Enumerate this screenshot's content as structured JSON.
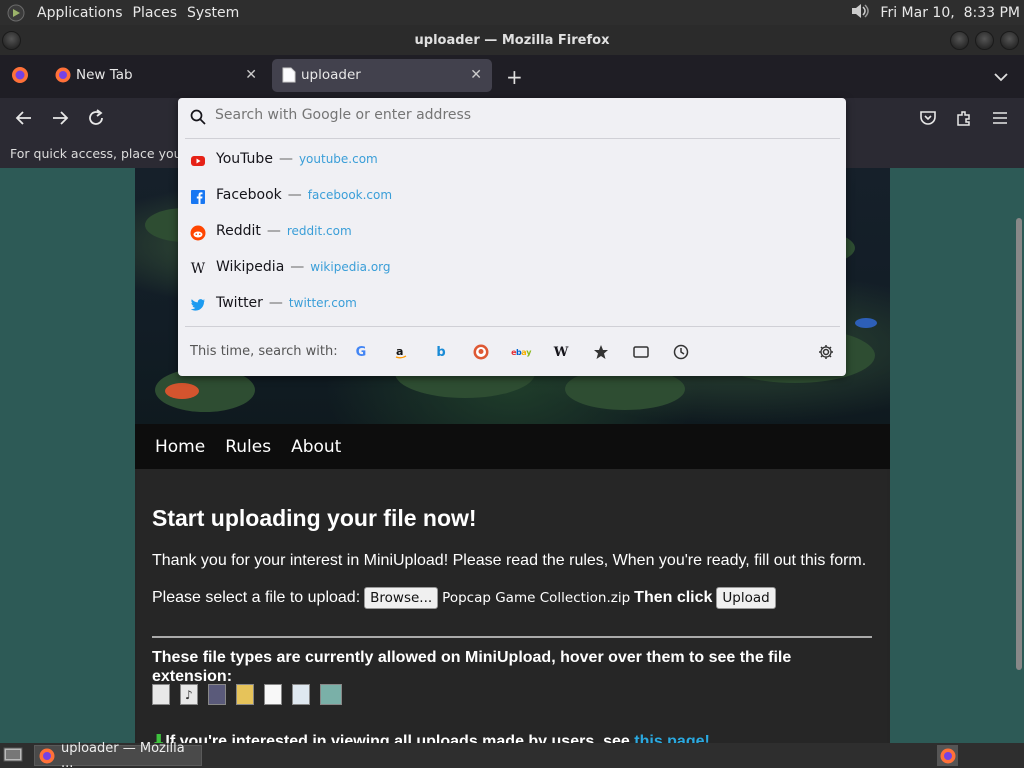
{
  "top_panel": {
    "menus": [
      "Applications",
      "Places",
      "System"
    ],
    "datetime": "Fri Mar 10,  8:33 PM"
  },
  "window": {
    "title": "uploader — Mozilla Firefox"
  },
  "tabs": [
    {
      "label": "New Tab"
    },
    {
      "label": "uploader"
    }
  ],
  "bookmarks_hint": "For quick access, place your",
  "urlbar": {
    "placeholder": "Search with Google or enter address",
    "suggestions": [
      {
        "name": "YouTube",
        "url": "youtube.com",
        "icon": "youtube-icon"
      },
      {
        "name": "Facebook",
        "url": "facebook.com",
        "icon": "facebook-icon"
      },
      {
        "name": "Reddit",
        "url": "reddit.com",
        "icon": "reddit-icon"
      },
      {
        "name": "Wikipedia",
        "url": "wikipedia.org",
        "icon": "wikipedia-icon"
      },
      {
        "name": "Twitter",
        "url": "twitter.com",
        "icon": "twitter-icon"
      }
    ],
    "search_with_label": "This time, search with:",
    "engines": [
      "google-icon",
      "amazon-icon",
      "bing-icon",
      "duckduckgo-icon",
      "ebay-icon",
      "wikipedia-icon",
      "bookmarks-icon",
      "tabs-icon",
      "history-icon"
    ]
  },
  "site": {
    "nav": [
      "Home",
      "Rules",
      "About"
    ],
    "heading": "Start uploading your file now!",
    "intro": "Thank you for your interest in MiniUpload! Please read the rules, When you're ready, fill out this form.",
    "select_label": "Please select a file to upload:",
    "browse_label": "Browse...",
    "filename": "Popcap Game Collection.zip",
    "then_click": "Then click",
    "upload_label": "Upload",
    "types_heading": "These file types are currently allowed on MiniUpload, hover over them to see the file extension:",
    "view_uploads_text": "If you're interested in viewing all uploads made by users, see",
    "view_uploads_link": "this page!"
  },
  "taskbar": {
    "item_label": "uploader — Mozilla ..."
  }
}
